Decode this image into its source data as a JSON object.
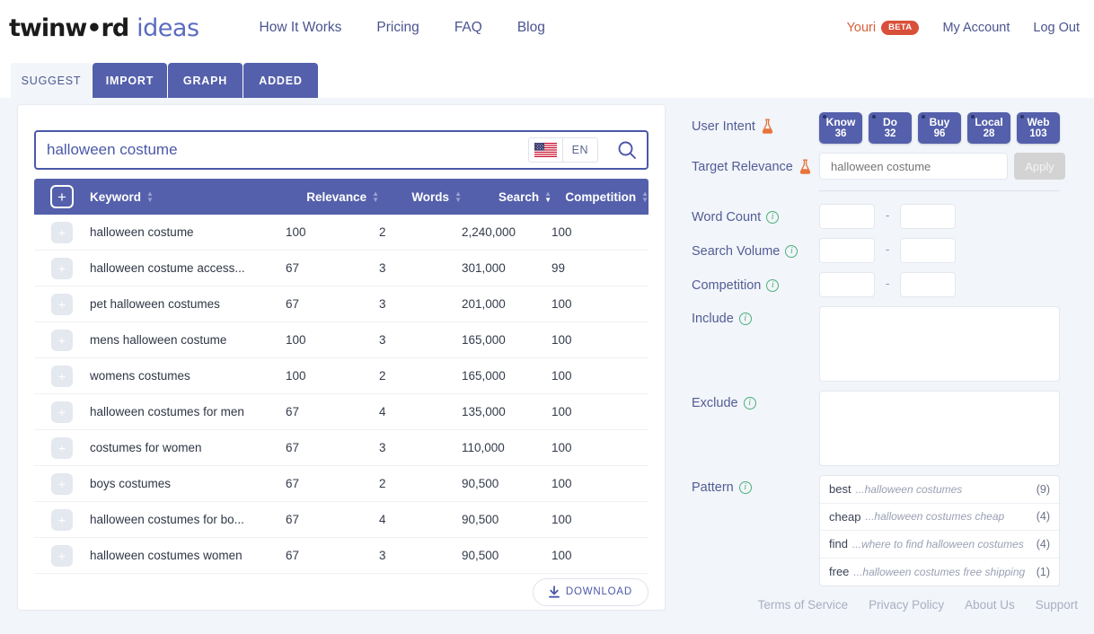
{
  "header": {
    "logo_dark": "twinw•rd",
    "logo_blue": "ideas",
    "nav": [
      {
        "label": "How It Works"
      },
      {
        "label": "Pricing"
      },
      {
        "label": "FAQ"
      },
      {
        "label": "Blog"
      }
    ],
    "user_name": "Youri",
    "beta_label": "BETA",
    "my_account": "My Account",
    "log_out": "Log Out",
    "accent_color": "#d9603b",
    "brand_color": "#5460ab"
  },
  "tabs": [
    {
      "label": "SUGGEST",
      "active": true
    },
    {
      "label": "IMPORT",
      "active": false
    },
    {
      "label": "GRAPH",
      "active": false
    },
    {
      "label": "ADDED",
      "active": false
    }
  ],
  "search": {
    "value": "halloween costume",
    "placeholder": "",
    "lang_code": "EN",
    "flag_icon": "us-flag-icon",
    "search_icon": "search-icon"
  },
  "table": {
    "add_all_label": "+",
    "columns": [
      {
        "label": "Keyword",
        "sort": "none"
      },
      {
        "label": "Relevance",
        "sort": "none"
      },
      {
        "label": "Words",
        "sort": "none"
      },
      {
        "label": "Search",
        "sort": "desc"
      },
      {
        "label": "Competition",
        "sort": "none"
      }
    ],
    "rows": [
      {
        "keyword": "halloween costume",
        "relevance": "100",
        "words": "2",
        "search": "2,240,000",
        "competition": "100"
      },
      {
        "keyword": "halloween costume access...",
        "relevance": "67",
        "words": "3",
        "search": "301,000",
        "competition": "99"
      },
      {
        "keyword": "pet halloween costumes",
        "relevance": "67",
        "words": "3",
        "search": "201,000",
        "competition": "100"
      },
      {
        "keyword": "mens halloween costume",
        "relevance": "100",
        "words": "3",
        "search": "165,000",
        "competition": "100"
      },
      {
        "keyword": "womens costumes",
        "relevance": "100",
        "words": "2",
        "search": "165,000",
        "competition": "100"
      },
      {
        "keyword": "halloween costumes for men",
        "relevance": "67",
        "words": "4",
        "search": "135,000",
        "competition": "100"
      },
      {
        "keyword": "costumes for women",
        "relevance": "67",
        "words": "3",
        "search": "110,000",
        "competition": "100"
      },
      {
        "keyword": "boys costumes",
        "relevance": "67",
        "words": "2",
        "search": "90,500",
        "competition": "100"
      },
      {
        "keyword": "halloween costumes for bo...",
        "relevance": "67",
        "words": "4",
        "search": "90,500",
        "competition": "100"
      },
      {
        "keyword": "halloween costumes women",
        "relevance": "67",
        "words": "3",
        "search": "90,500",
        "competition": "100"
      }
    ],
    "download_label": "DOWNLOAD"
  },
  "filters": {
    "user_intent_label": "User Intent",
    "user_intent": [
      {
        "name": "Know",
        "value": "36"
      },
      {
        "name": "Do",
        "value": "32"
      },
      {
        "name": "Buy",
        "value": "96"
      },
      {
        "name": "Local",
        "value": "28"
      },
      {
        "name": "Web",
        "value": "103"
      }
    ],
    "target_relevance_label": "Target Relevance",
    "target_relevance_placeholder": "halloween costume",
    "target_relevance_value": "",
    "apply_label": "Apply",
    "word_count_label": "Word Count",
    "word_count_min": "",
    "word_count_max": "",
    "search_volume_label": "Search Volume",
    "search_volume_min": "",
    "search_volume_max": "",
    "competition_label": "Competition",
    "competition_min": "",
    "competition_max": "",
    "include_label": "Include",
    "include_value": "",
    "exclude_label": "Exclude",
    "exclude_value": "",
    "pattern_label": "Pattern",
    "patterns": [
      {
        "word": "best",
        "phrase": "...halloween costumes",
        "count": "(9)"
      },
      {
        "word": "cheap",
        "phrase": "...halloween costumes cheap",
        "count": "(4)"
      },
      {
        "word": "find",
        "phrase": "...where to find halloween costumes",
        "count": "(4)"
      },
      {
        "word": "free",
        "phrase": "...halloween costumes free shipping",
        "count": "(1)"
      }
    ]
  },
  "footer": {
    "links": [
      {
        "label": "Terms of Service"
      },
      {
        "label": "Privacy Policy"
      },
      {
        "label": "About Us"
      },
      {
        "label": "Support"
      }
    ]
  }
}
